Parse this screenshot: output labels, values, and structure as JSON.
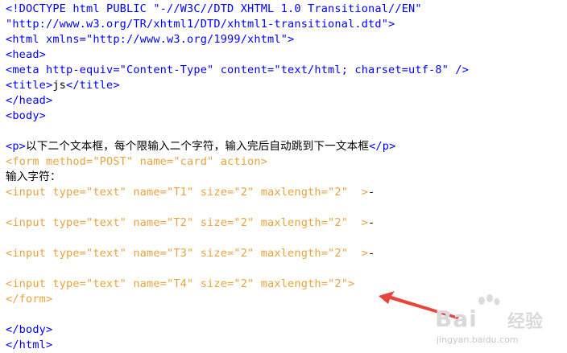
{
  "colors": {
    "tag": "#0000ff",
    "form_html": "#e8a33d",
    "text": "#000000",
    "arrow": "#e8443a"
  },
  "lines": [
    {
      "segments": [
        {
          "t": "<!DOCTYPE html PUBLIC \"-//W3C//DTD XHTML 1.0 Transitional//EN\"",
          "c": "blue"
        }
      ]
    },
    {
      "segments": [
        {
          "t": "\"http://www.w3.org/TR/xhtml1/DTD/xhtml1-transitional.dtd\">",
          "c": "blue"
        }
      ]
    },
    {
      "segments": [
        {
          "t": "<html xmlns=\"http://www.w3.org/1999/xhtml\">",
          "c": "blue"
        }
      ]
    },
    {
      "segments": [
        {
          "t": "<head>",
          "c": "blue"
        }
      ]
    },
    {
      "segments": [
        {
          "t": "<meta http-equiv=\"Content-Type\" content=\"text/html; charset=utf-8\" />",
          "c": "blue"
        }
      ]
    },
    {
      "segments": [
        {
          "t": "<title>",
          "c": "blue"
        },
        {
          "t": "js",
          "c": "black"
        },
        {
          "t": "</title>",
          "c": "blue"
        }
      ]
    },
    {
      "segments": [
        {
          "t": "</head>",
          "c": "blue"
        }
      ]
    },
    {
      "segments": [
        {
          "t": "<body>",
          "c": "blue"
        }
      ]
    },
    {
      "segments": []
    },
    {
      "segments": [
        {
          "t": "<p>",
          "c": "blue"
        },
        {
          "t": "以下二个文本框，每个限输入二个字符，输入完后自动跳到下一文本框",
          "c": "black",
          "cjk": true
        },
        {
          "t": "</p>",
          "c": "blue"
        }
      ]
    },
    {
      "segments": [
        {
          "t": "<form method=\"POST\" name=\"card\" action>",
          "c": "orange"
        }
      ]
    },
    {
      "segments": [
        {
          "t": "输入字符：",
          "c": "black",
          "cjk": true
        }
      ]
    },
    {
      "segments": [
        {
          "t": "<input type=\"text\" name=\"T1\" size=\"2\" maxlength=\"2\"  >",
          "c": "orange"
        },
        {
          "t": "-",
          "c": "black"
        }
      ]
    },
    {
      "segments": []
    },
    {
      "segments": [
        {
          "t": "<input type=\"text\" name=\"T2\" size=\"2\" maxlength=\"2\"  >",
          "c": "orange"
        },
        {
          "t": "-",
          "c": "black"
        }
      ]
    },
    {
      "segments": []
    },
    {
      "segments": [
        {
          "t": "<input type=\"text\" name=\"T3\" size=\"2\" maxlength=\"2\"  >",
          "c": "orange"
        },
        {
          "t": "-",
          "c": "black"
        }
      ]
    },
    {
      "segments": []
    },
    {
      "segments": [
        {
          "t": "<input type=\"text\" name=\"T4\" size=\"2\" maxlength=\"2\">",
          "c": "orange"
        }
      ]
    },
    {
      "segments": [
        {
          "t": "</form>",
          "c": "orange"
        }
      ]
    },
    {
      "segments": []
    },
    {
      "segments": [
        {
          "t": "</body>",
          "c": "blue"
        }
      ]
    },
    {
      "segments": [
        {
          "t": "</html>",
          "c": "blue"
        }
      ]
    }
  ],
  "watermark": {
    "logo": "Bai",
    "logo_suffix": "经验",
    "url": "jingyan.baidu.com",
    "icon": "paw-icon"
  },
  "annotation": {
    "icon": "red-arrow-icon"
  }
}
